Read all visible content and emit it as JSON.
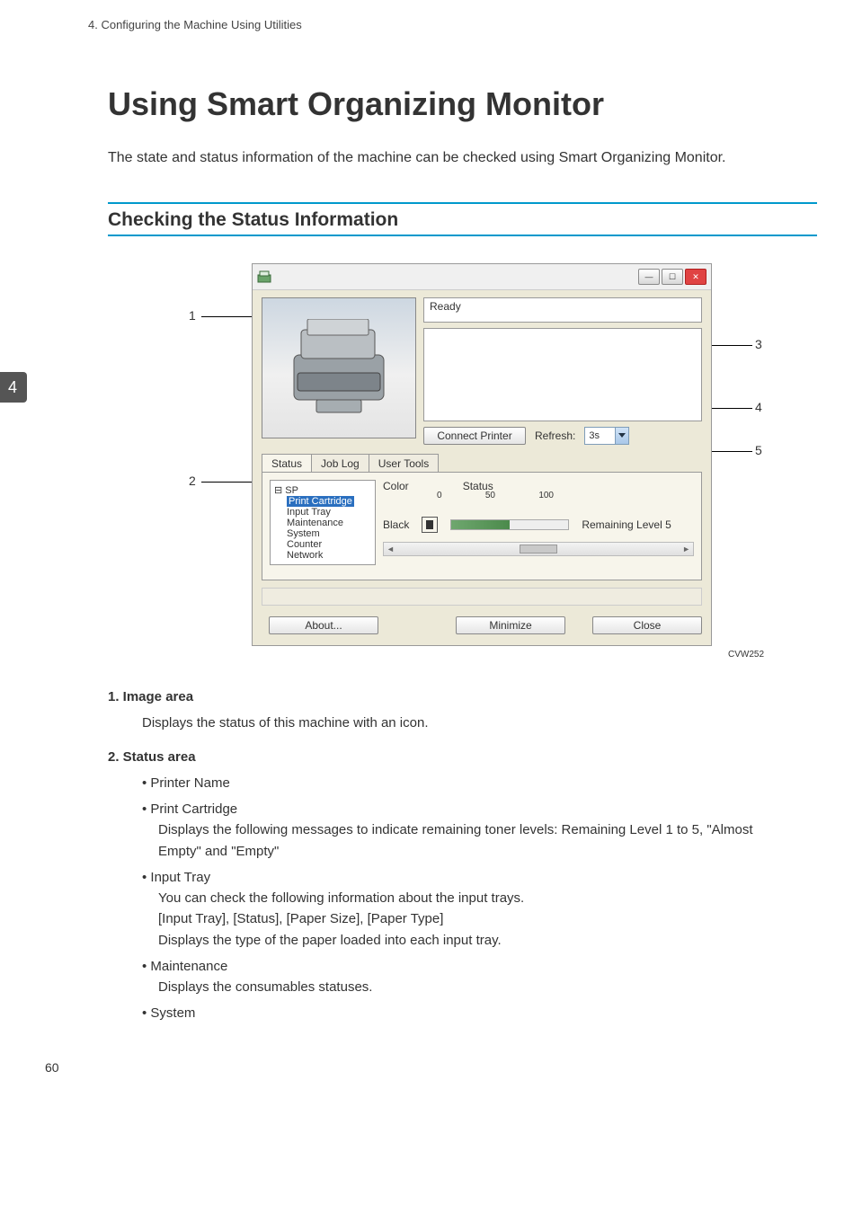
{
  "header": {
    "chapter": "4. Configuring the Machine Using Utilities"
  },
  "side_tab": "4",
  "title": "Using Smart Organizing Monitor",
  "intro": "The state and status information of the machine can be checked using Smart Organizing Monitor.",
  "section": "Checking the Status Information",
  "dialog": {
    "status_text": "Ready",
    "connect_btn": "Connect Printer",
    "refresh_label": "Refresh:",
    "refresh_value": "3s",
    "tabs": [
      "Status",
      "Job Log",
      "User Tools"
    ],
    "tree_root": "SP",
    "tree_items": [
      "Print Cartridge",
      "Input Tray",
      "Maintenance",
      "System",
      "Counter",
      "Network"
    ],
    "col_color": "Color",
    "col_status": "Status",
    "row_color": "Black",
    "scale": [
      "0",
      "50",
      "100"
    ],
    "remaining": "Remaining Level 5",
    "about_btn": "About...",
    "minimize_btn": "Minimize",
    "close_btn": "Close"
  },
  "callouts": {
    "c1": "1",
    "c2": "2",
    "c3": "3",
    "c4": "4",
    "c5": "5"
  },
  "figure_id": "CVW252",
  "desc": {
    "i1_h": "1.  Image area",
    "i1_b": "Displays the status of this machine with an icon.",
    "i2_h": "2.  Status area",
    "i2_pn": "Printer Name",
    "i2_pc": "Print Cartridge",
    "i2_pc_b": "Displays the following messages to indicate remaining toner levels: Remaining Level 1 to 5, \"Almost Empty\" and \"Empty\"",
    "i2_it": "Input Tray",
    "i2_it_b1": "You can check the following information about the input trays.",
    "i2_it_b2": "[Input Tray], [Status], [Paper Size], [Paper Type]",
    "i2_it_b3": "Displays the type of the paper loaded into each input tray.",
    "i2_mn": "Maintenance",
    "i2_mn_b": "Displays the consumables statuses.",
    "i2_sy": "System"
  },
  "page_number": "60"
}
